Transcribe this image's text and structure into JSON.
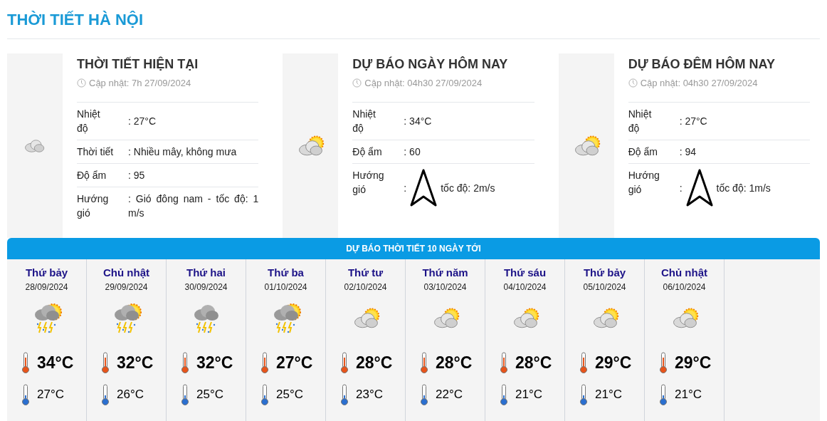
{
  "page_title": "THỜI TIẾT HÀ NỘI",
  "cards": [
    {
      "title": "THỜI TIẾT HIỆN TẠI",
      "kind": "cloudy",
      "updated": "Cập nhật: 7h 27/09/2024",
      "rows": [
        {
          "kind": "text",
          "label": "Nhiệt độ",
          "value": ": 27°C"
        },
        {
          "kind": "text",
          "label": "Thời tiết",
          "value": ": Nhiều mây, không mưa"
        },
        {
          "kind": "text",
          "label": "Độ ẩm",
          "value": ": 95"
        },
        {
          "kind": "text",
          "label": "Hướng gió",
          "value": ": Gió đông nam - tốc độ: 1 m/s"
        }
      ]
    },
    {
      "title": "DỰ BÁO NGÀY HÔM NAY",
      "kind": "partly-cloudy",
      "updated": "Cập nhật: 04h30 27/09/2024",
      "rows": [
        {
          "kind": "text",
          "label": "Nhiệt độ",
          "value": ": 34°C"
        },
        {
          "kind": "text",
          "label": "Độ ẩm",
          "value": ": 60"
        },
        {
          "kind": "wind",
          "label": "Hướng gió",
          "prefix": ":",
          "value": "tốc độ: 2m/s"
        }
      ]
    },
    {
      "title": "DỰ BÁO ĐÊM HÔM NAY",
      "kind": "partly-cloudy",
      "updated": "Cập nhật: 04h30 27/09/2024",
      "rows": [
        {
          "kind": "text",
          "label": "Nhiệt độ",
          "value": ": 27°C"
        },
        {
          "kind": "text",
          "label": "Độ ẩm",
          "value": ": 94"
        },
        {
          "kind": "wind",
          "label": "Hướng gió",
          "prefix": ":",
          "value": "tốc độ: 1m/s"
        }
      ]
    }
  ],
  "forecast": {
    "title": "DỰ BÁO THỜI TIẾT 10 NGÀY TỚI",
    "days": [
      {
        "day": "Thứ bảy",
        "date": "28/09/2024",
        "kind": "thunder-sun",
        "high": "34°C",
        "low": "27°C"
      },
      {
        "day": "Chủ nhật",
        "date": "29/09/2024",
        "kind": "thunder-sun",
        "high": "32°C",
        "low": "26°C"
      },
      {
        "day": "Thứ hai",
        "date": "30/09/2024",
        "kind": "thunder",
        "high": "32°C",
        "low": "25°C"
      },
      {
        "day": "Thứ ba",
        "date": "01/10/2024",
        "kind": "thunder-sun",
        "high": "27°C",
        "low": "25°C"
      },
      {
        "day": "Thứ tư",
        "date": "02/10/2024",
        "kind": "partly-cloudy",
        "high": "28°C",
        "low": "23°C"
      },
      {
        "day": "Thứ năm",
        "date": "03/10/2024",
        "kind": "partly-cloudy",
        "high": "28°C",
        "low": "22°C"
      },
      {
        "day": "Thứ sáu",
        "date": "04/10/2024",
        "kind": "partly-cloudy",
        "high": "28°C",
        "low": "21°C"
      },
      {
        "day": "Thứ bảy",
        "date": "05/10/2024",
        "kind": "partly-cloudy",
        "high": "29°C",
        "low": "21°C"
      },
      {
        "day": "Chủ nhật",
        "date": "06/10/2024",
        "kind": "partly-cloudy",
        "high": "29°C",
        "low": "21°C"
      }
    ]
  }
}
